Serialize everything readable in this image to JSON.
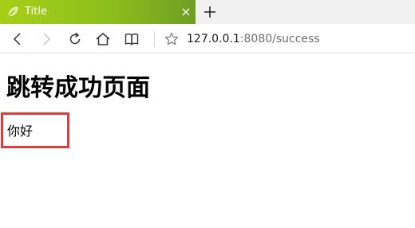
{
  "tab": {
    "title": "Title",
    "favicon": "leaf-icon"
  },
  "toolbar": {
    "icons": [
      "back-arrow-icon",
      "forward-arrow-icon",
      "refresh-icon",
      "home-icon",
      "reading-view-icon",
      "favorite-star-icon",
      "close-icon",
      "new-tab-plus-icon"
    ],
    "url_host": "127.0.0.1",
    "url_rest": ":8080/success"
  },
  "page": {
    "heading": "跳转成功页面",
    "greeting": "你好"
  },
  "colors": {
    "tab_gradient_start": "#a6cf18",
    "tab_gradient_end": "#6e9e22",
    "highlight_border": "#e03c3c"
  }
}
